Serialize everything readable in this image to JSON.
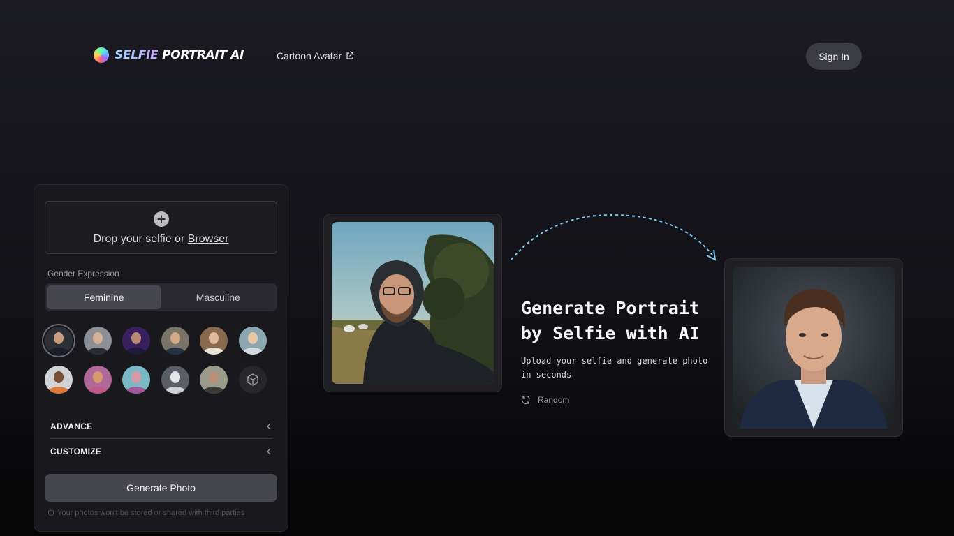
{
  "header": {
    "logo_word1": "SELFIE",
    "logo_word2": "PORTRAIT AI",
    "nav_link": "Cartoon Avatar",
    "signin_label": "Sign In"
  },
  "upload": {
    "prompt": "Drop your selfie or",
    "browse_link": "Browser"
  },
  "gender": {
    "label": "Gender Expression",
    "options": [
      "Feminine",
      "Masculine"
    ],
    "selected": "Feminine"
  },
  "styles": {
    "selected_index": 0
  },
  "accordions": {
    "advance": "ADVANCE",
    "customize": "CUSTOMIZE"
  },
  "actions": {
    "generate_label": "Generate Photo",
    "privacy_note": "Your photos won't be stored or shared with third parties"
  },
  "hero": {
    "title_line1": "Generate Portrait",
    "title_line2": "by Selfie with AI",
    "subtitle": "Upload your selfie and generate photo in seconds",
    "random_label": "Random"
  },
  "colors": {
    "accent_arrow": "#7fc8f0",
    "button_bg": "#46464d",
    "panel_bg": "#19191d"
  }
}
